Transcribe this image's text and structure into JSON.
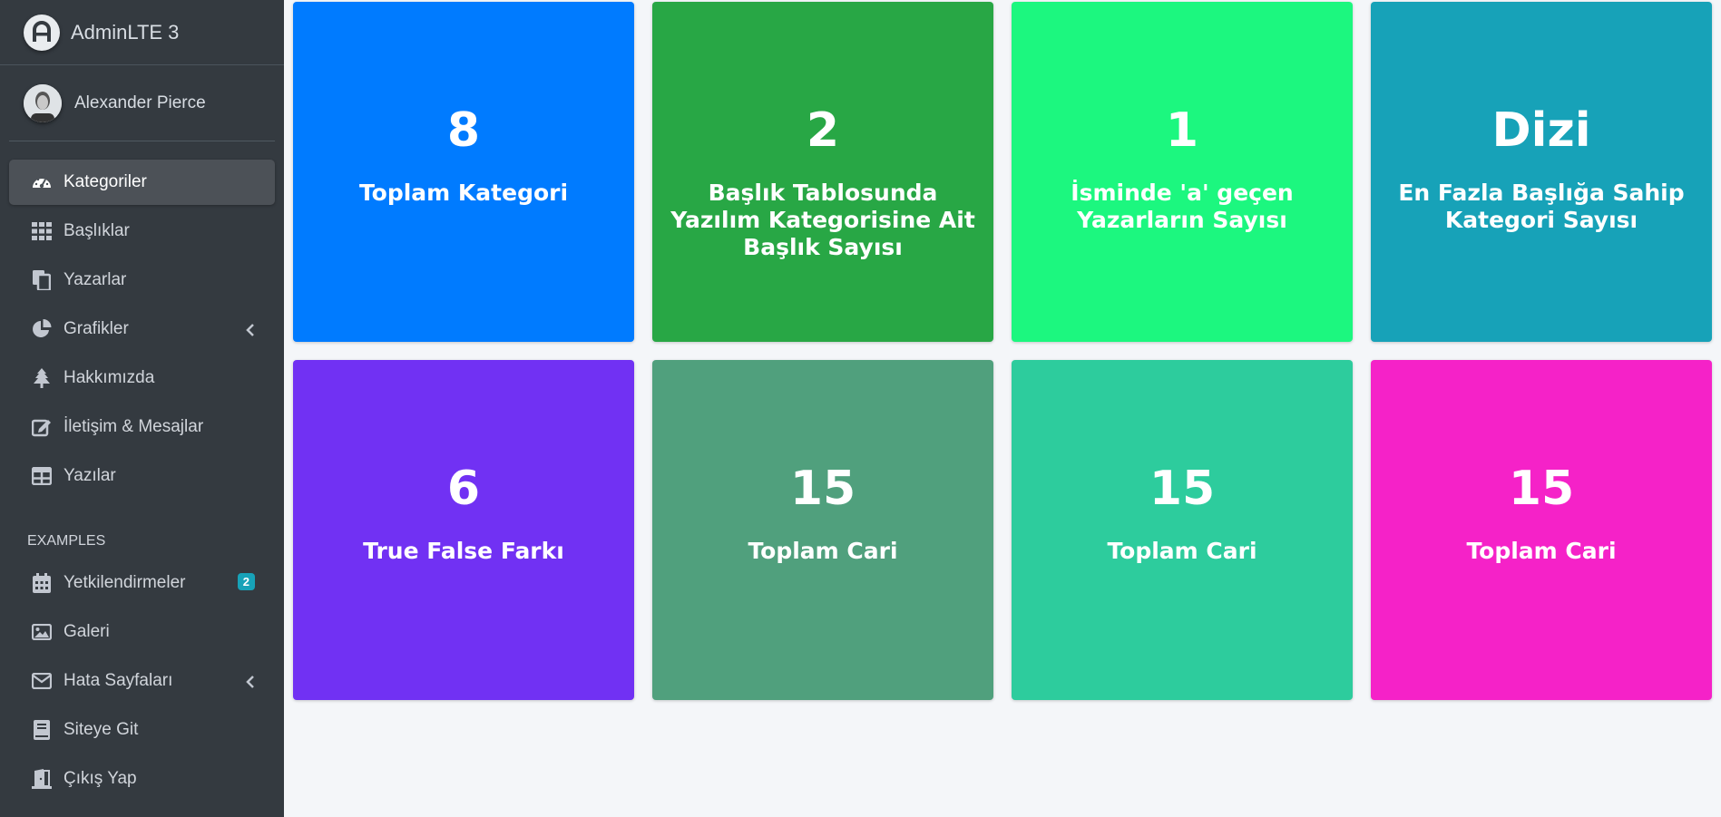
{
  "brand": {
    "logo_letter": "A",
    "title": "AdminLTE 3"
  },
  "user": {
    "name": "Alexander Pierce"
  },
  "nav": {
    "items": [
      {
        "label": "Kategoriler",
        "icon": "dashboard-gauge-icon",
        "active": true
      },
      {
        "label": "Başlıklar",
        "icon": "grid-icon"
      },
      {
        "label": "Yazarlar",
        "icon": "copy-icon"
      },
      {
        "label": "Grafikler",
        "icon": "pie-chart-icon",
        "has_arrow": true
      },
      {
        "label": "Hakkımızda",
        "icon": "tree-icon"
      },
      {
        "label": "İletişim & Mesajlar",
        "icon": "edit-icon"
      },
      {
        "label": "Yazılar",
        "icon": "table-icon"
      }
    ],
    "section_header": "EXAMPLES",
    "example_items": [
      {
        "label": "Yetkilendirmeler",
        "icon": "calendar-icon",
        "badge": "2"
      },
      {
        "label": "Galeri",
        "icon": "image-icon"
      },
      {
        "label": "Hata Sayfaları",
        "icon": "envelope-icon",
        "has_arrow": true
      },
      {
        "label": "Siteye Git",
        "icon": "book-icon"
      },
      {
        "label": "Çıkış Yap",
        "icon": "door-icon"
      }
    ]
  },
  "cards": [
    {
      "value": "8",
      "label": "Toplam Kategori",
      "color": "#007bff"
    },
    {
      "value": "2",
      "label": "Başlık Tablosunda Yazılım Kategorisine Ait Başlık Sayısı",
      "color": "#28a745"
    },
    {
      "value": "1",
      "label": "İsminde 'a' geçen Yazarların Sayısı",
      "color": "#1cf77f"
    },
    {
      "value": "Dizi",
      "label": "En Fazla Başlığa Sahip Kategori Sayısı",
      "color": "#17a2b8"
    },
    {
      "value": "6",
      "label": "True False Farkı",
      "color": "#7131f3"
    },
    {
      "value": "15",
      "label": "Toplam Cari",
      "color": "#50a07d"
    },
    {
      "value": "15",
      "label": "Toplam Cari",
      "color": "#2dcc9d"
    },
    {
      "value": "15",
      "label": "Toplam Cari",
      "color": "#f522c8"
    }
  ]
}
